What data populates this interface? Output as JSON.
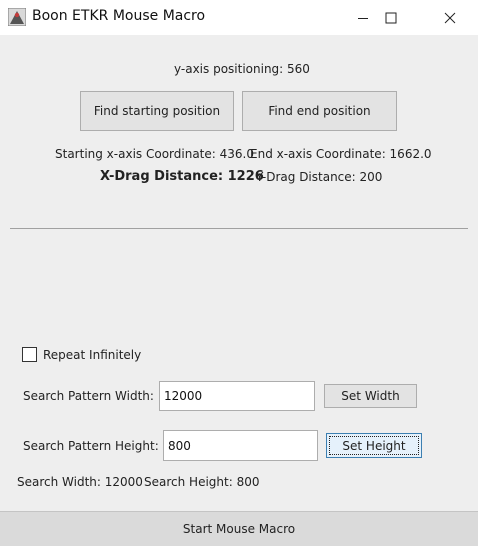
{
  "window": {
    "title": "Boon ETKR Mouse Macro",
    "icon": "app-icon",
    "minimize_icon": "minimize-icon",
    "maximize_icon": "maximize-icon",
    "close_icon": "close-icon"
  },
  "main": {
    "y_axis_label": "y-axis positioning: 560",
    "find_start_label": "Find starting position",
    "find_end_label": "Find end position",
    "start_x_label": "Starting x-axis Coordinate: 436.0",
    "end_x_label": "End x-axis Coordinate: 1662.0",
    "x_drag_label": "X-Drag Distance: 1226",
    "y_drag_label": "Y-Drag Distance: 200"
  },
  "settings": {
    "repeat_label": "Repeat Infinitely",
    "repeat_checked": false,
    "width_label": "Search Pattern Width:",
    "width_value": "12000",
    "set_width_label": "Set Width",
    "height_label": "Search Pattern Height:",
    "height_value": "800",
    "set_height_label": "Set Height",
    "search_width_status": "Search Width: 12000",
    "search_height_status": "Search Height: 800"
  },
  "footer": {
    "start_label": "Start Mouse Macro"
  }
}
